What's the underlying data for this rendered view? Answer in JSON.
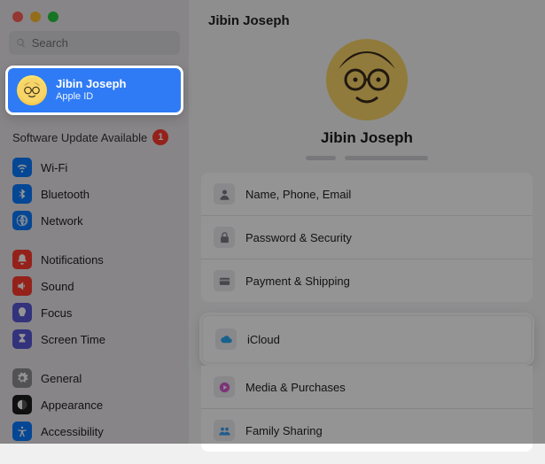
{
  "search": {
    "placeholder": "Search"
  },
  "account": {
    "name": "Jibin Joseph",
    "subtitle": "Apple ID"
  },
  "update": {
    "label": "Software Update Available",
    "count": "1"
  },
  "sidebar": {
    "groups": [
      [
        {
          "label": "Wi-Fi",
          "icon": "wifi",
          "cls": "ic-blue"
        },
        {
          "label": "Bluetooth",
          "icon": "bluetooth",
          "cls": "ic-blue"
        },
        {
          "label": "Network",
          "icon": "network",
          "cls": "ic-blue"
        }
      ],
      [
        {
          "label": "Notifications",
          "icon": "bell",
          "cls": "ic-red"
        },
        {
          "label": "Sound",
          "icon": "sound",
          "cls": "ic-red"
        },
        {
          "label": "Focus",
          "icon": "focus",
          "cls": "ic-purple"
        },
        {
          "label": "Screen Time",
          "icon": "hourglass",
          "cls": "ic-purple"
        }
      ],
      [
        {
          "label": "General",
          "icon": "gear",
          "cls": "ic-gray"
        },
        {
          "label": "Appearance",
          "icon": "appearance",
          "cls": "ic-black"
        },
        {
          "label": "Accessibility",
          "icon": "accessibility",
          "cls": "ic-blue"
        }
      ]
    ]
  },
  "main": {
    "title": "Jibin Joseph",
    "profile_name": "Jibin Joseph",
    "rows": [
      {
        "label": "Name, Phone, Email",
        "icon": "person"
      },
      {
        "label": "Password & Security",
        "icon": "lock"
      },
      {
        "label": "Payment & Shipping",
        "icon": "card"
      },
      {
        "label": "iCloud",
        "icon": "cloud",
        "highlight": true
      },
      {
        "label": "Media & Purchases",
        "icon": "media"
      },
      {
        "label": "Family Sharing",
        "icon": "family"
      }
    ]
  }
}
